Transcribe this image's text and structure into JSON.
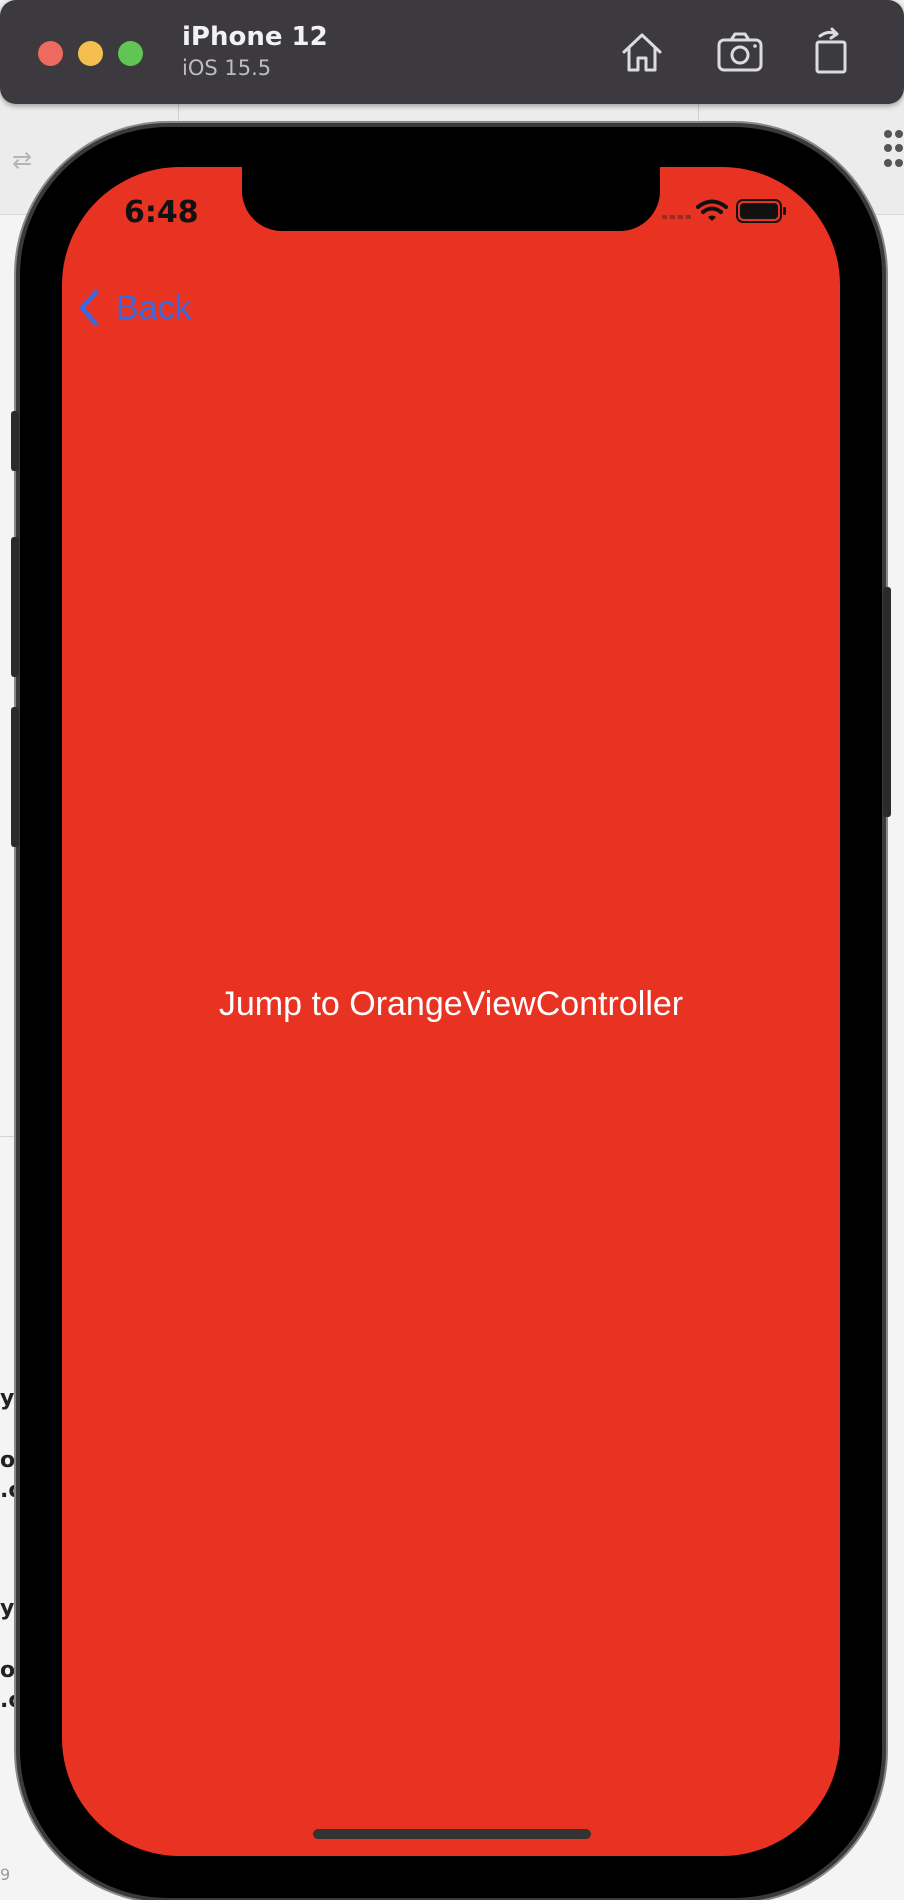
{
  "simulator": {
    "device_name": "iPhone 12",
    "os_version": "iOS 15.5",
    "toolbar_icons": [
      "home-icon",
      "screenshot-icon",
      "rotate-icon"
    ]
  },
  "status_bar": {
    "time": "6:48",
    "icons": [
      "signal-icon",
      "wifi-icon",
      "battery-icon"
    ]
  },
  "navigation": {
    "back_label": "Back",
    "back_icon": "chevron-left-icon"
  },
  "content": {
    "jump_button_label": "Jump to OrangeViewController",
    "background_color": "#e83222"
  },
  "colors": {
    "accent": "#3a6ae0",
    "screen_background": "#e83222",
    "titlebar": "#3c3a3e"
  },
  "background_fragments": {
    "code_lines": [
      "yb",
      "ou",
      ".c",
      "yb",
      "ou",
      ".c"
    ],
    "line_number": "9"
  }
}
